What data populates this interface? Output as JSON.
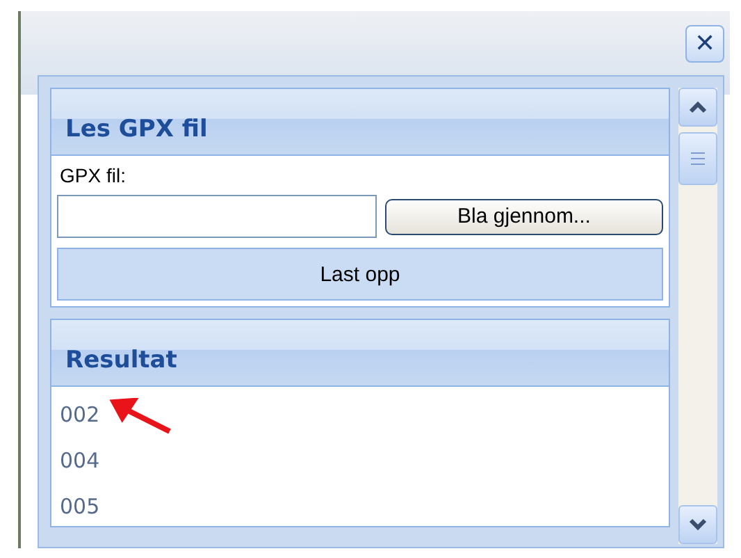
{
  "dialog": {
    "close": "✕"
  },
  "sections": [
    {
      "kind": "form",
      "title": "Les GPX fil",
      "field_label": "GPX fil:",
      "browse_button": "Bla gjennom...",
      "upload_button": "Last opp"
    },
    {
      "kind": "list",
      "title": "Resultat",
      "items": [
        "002",
        "004",
        "005"
      ]
    }
  ]
}
